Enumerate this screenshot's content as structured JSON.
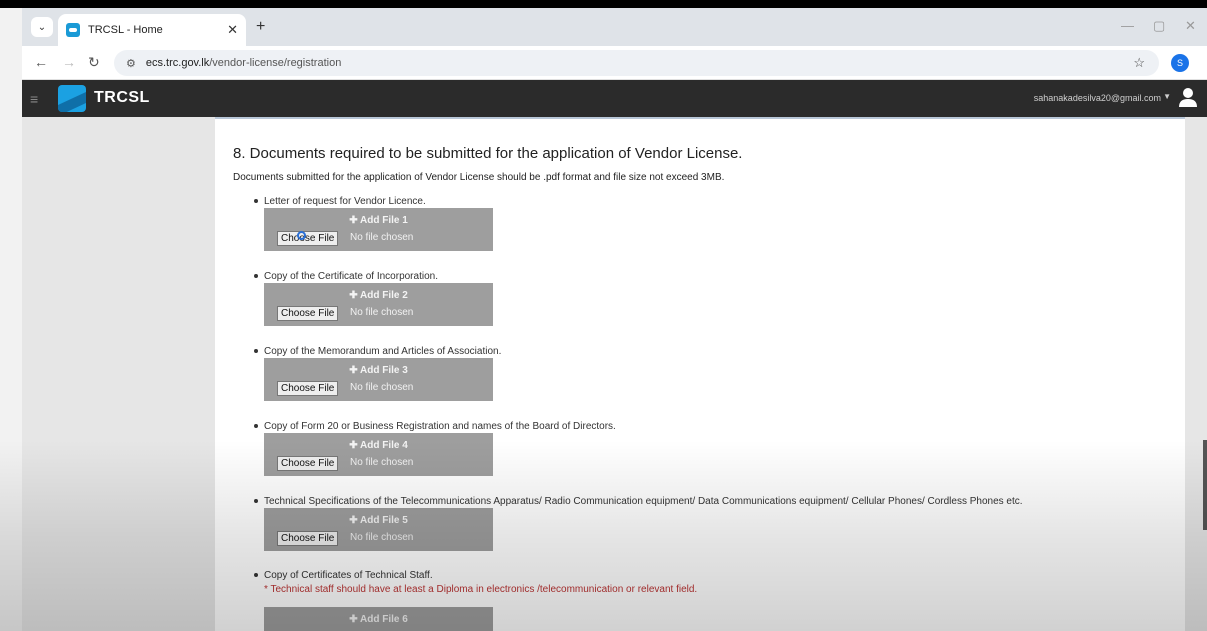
{
  "browser": {
    "tab_title": "TRCSL - Home",
    "new_tab": "+",
    "url_domain": "ecs.trc.gov.lk",
    "url_path": "/vendor-license/registration",
    "profile_initial": "S"
  },
  "app": {
    "logo_text": "TRCSL",
    "user_email": "sahanakadesilva20@gmail.com"
  },
  "section": {
    "title": "8. Documents required to be submitted for the application of Vendor License.",
    "subtitle": "Documents submitted for the application of Vendor License should be .pdf format and file size not exceed 3MB."
  },
  "documents": [
    {
      "label": "Letter of request for Vendor Licence.",
      "add": "✚ Add File 1",
      "choose": "Choose File",
      "status": "No file chosen"
    },
    {
      "label": "Copy of the Certificate of Incorporation.",
      "add": "✚ Add File 2",
      "choose": "Choose File",
      "status": "No file chosen"
    },
    {
      "label": "Copy of the Memorandum and Articles of Association.",
      "add": "✚ Add File 3",
      "choose": "Choose File",
      "status": "No file chosen"
    },
    {
      "label": "Copy of Form 20 or Business Registration and names of the Board of Directors.",
      "add": "✚ Add File 4",
      "choose": "Choose File",
      "status": "No file chosen"
    },
    {
      "label": "Technical Specifications of the Telecommunications Apparatus/ Radio Communication equipment/ Data Communications equipment/ Cellular Phones/ Cordless Phones etc.",
      "add": "✚ Add File 5",
      "choose": "Choose File",
      "status": "No file chosen"
    },
    {
      "label": "Copy of Certificates of Technical Staff.",
      "note": "* Technical staff should have at least a Diploma in electronics /telecommunication or relevant field.",
      "add": "✚ Add File 6"
    }
  ]
}
